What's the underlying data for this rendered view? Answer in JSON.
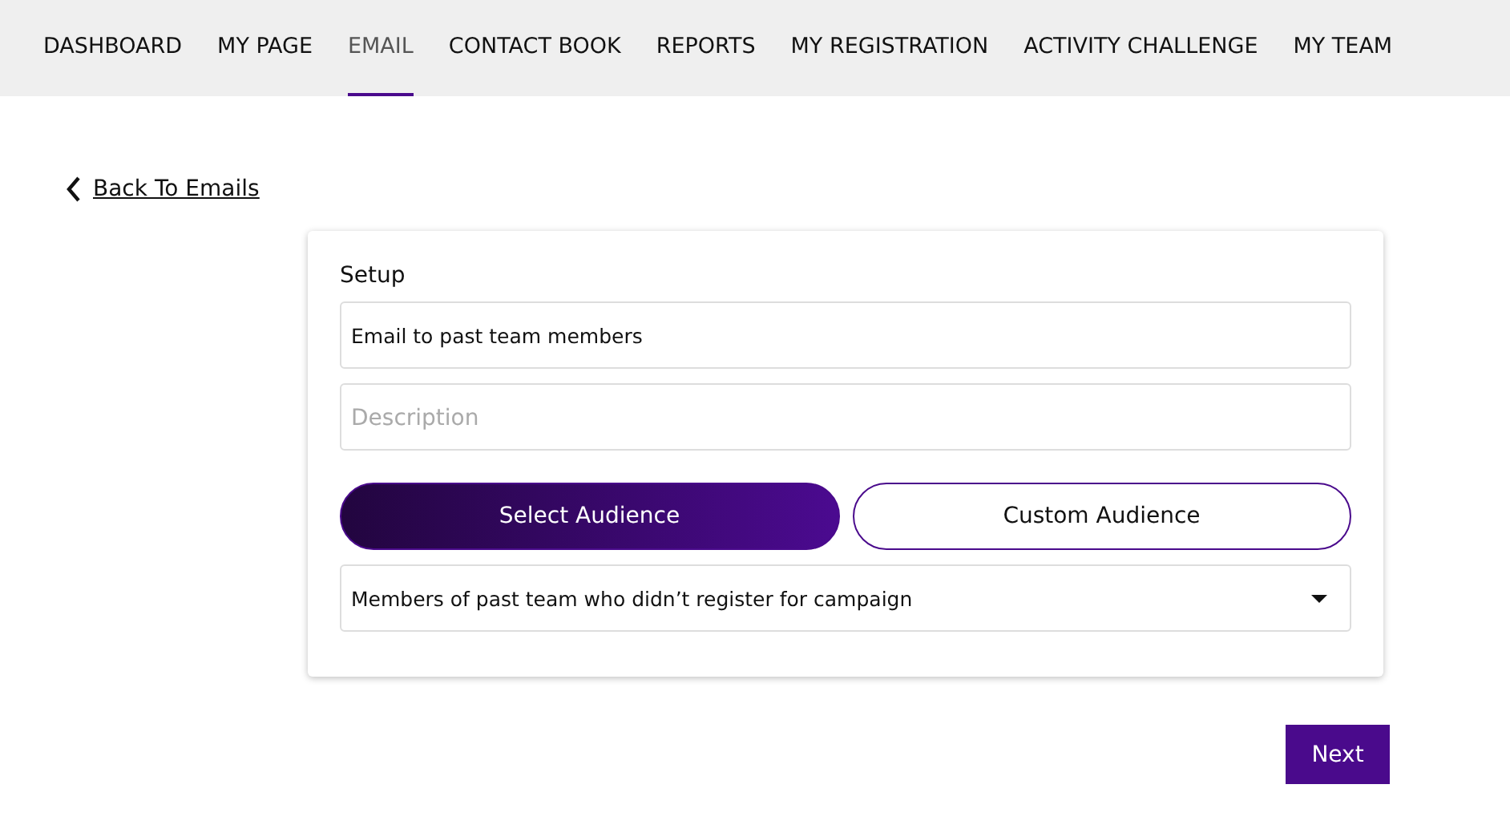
{
  "nav": [
    {
      "label": "DASHBOARD",
      "selected": false
    },
    {
      "label": "MY PAGE",
      "selected": false
    },
    {
      "label": "EMAIL",
      "selected": true
    },
    {
      "label": "CONTACT BOOK",
      "selected": false
    },
    {
      "label": "REPORTS",
      "selected": false
    },
    {
      "label": "MY REGISTRATION",
      "selected": false
    },
    {
      "label": "ACTIVITY CHALLENGE",
      "selected": false
    },
    {
      "label": "MY TEAM",
      "selected": false
    }
  ],
  "back_link": "Back To Emails",
  "setup": {
    "heading": "Setup",
    "name_field": {
      "value": "Email to past team members"
    },
    "description_field": {
      "placeholder": "Description"
    },
    "audience_buttons": [
      {
        "label": "Select Audience",
        "selected": true
      },
      {
        "label": "Custom Audience",
        "selected": false
      }
    ],
    "audience_dropdown": {
      "value": "Members of past team who didn’t register for campaign"
    }
  },
  "next_button": "Next"
}
